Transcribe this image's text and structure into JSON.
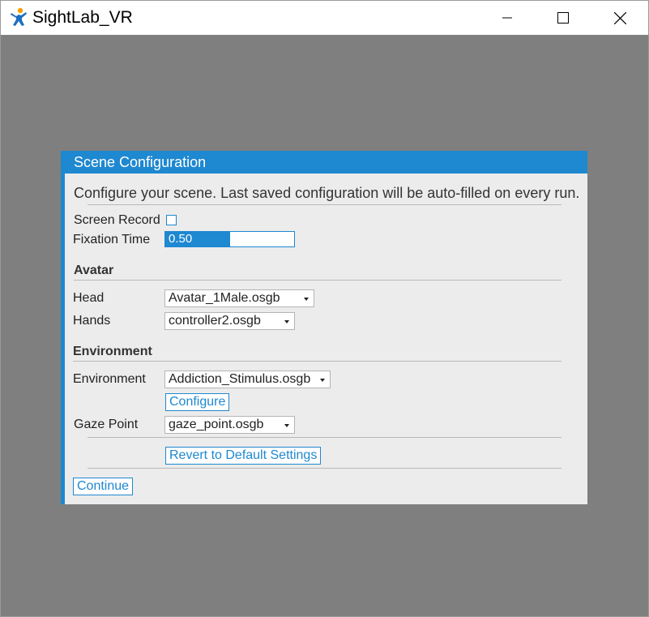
{
  "window": {
    "title": "SightLab_VR",
    "icon": "sightlab-person-icon"
  },
  "dialog": {
    "title": "Scene Configuration",
    "intro": "Configure your scene. Last saved configuration will be auto-filled on every run.",
    "screen_record": {
      "label": "Screen Record",
      "checked": false
    },
    "fixation_time": {
      "label": "Fixation Time",
      "value": "0.50",
      "fill_fraction": 0.5
    },
    "avatar": {
      "section_title": "Avatar",
      "head_label": "Head",
      "head_value": "Avatar_1Male.osgb",
      "hands_label": "Hands",
      "hands_value": "controller2.osgb"
    },
    "environment": {
      "section_title": "Environment",
      "environment_label": "Environment",
      "environment_value": "Addiction_Stimulus.osgb",
      "configure_label": "Configure",
      "gaze_point_label": "Gaze Point",
      "gaze_point_value": "gaze_point.osgb"
    },
    "revert_label": "Revert to Default Settings",
    "continue_label": "Continue"
  },
  "colors": {
    "accent": "#1e88d0",
    "background": "#7f7f7f",
    "panel": "#ececec"
  }
}
